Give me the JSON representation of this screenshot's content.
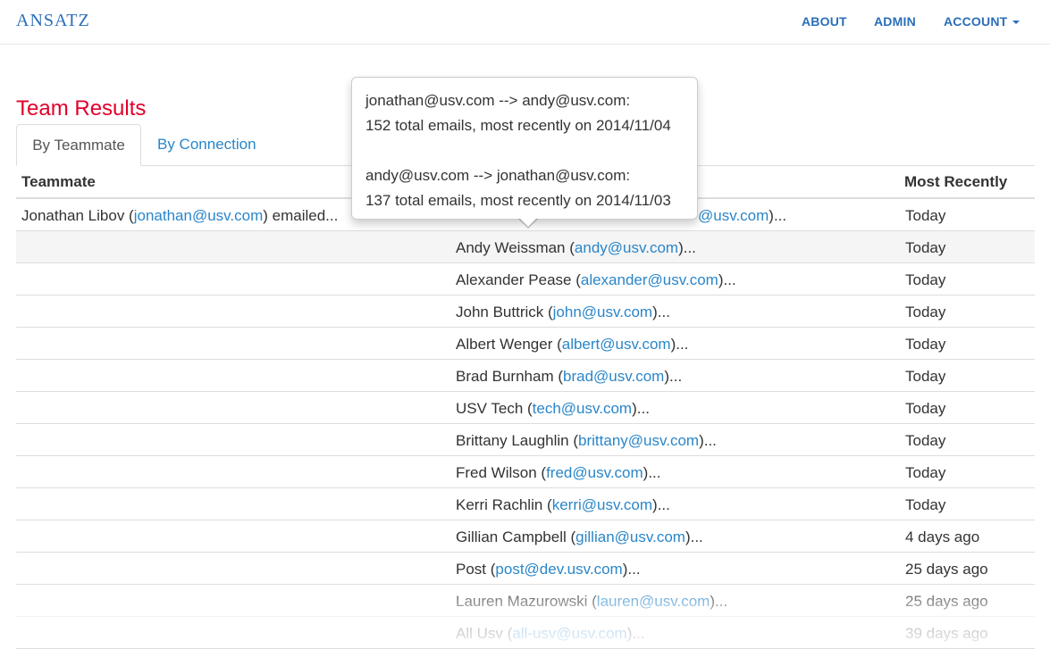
{
  "nav": {
    "brand": "ANSATZ",
    "links": [
      {
        "label": "ABOUT"
      },
      {
        "label": "ADMIN"
      },
      {
        "label": "ACCOUNT"
      }
    ]
  },
  "page": {
    "title": "Team Results"
  },
  "tabs": [
    {
      "label": "By Teammate",
      "active": true
    },
    {
      "label": "By Connection",
      "active": false
    }
  ],
  "table": {
    "headers": [
      "Teammate",
      "",
      "Most Recently"
    ],
    "first_row": {
      "name": "Jonathan Libov",
      "email": "jonathan@usv.com",
      "suffix": " emailed...",
      "hidden_tail": "@usv.com",
      "hidden_tail_after": ")...",
      "recent": "Today"
    },
    "rows": [
      {
        "name": "Andy Weissman",
        "email": "andy@usv.com",
        "recent": "Today"
      },
      {
        "name": "Alexander Pease",
        "email": "alexander@usv.com",
        "recent": "Today"
      },
      {
        "name": "John Buttrick",
        "email": "john@usv.com",
        "recent": "Today"
      },
      {
        "name": "Albert Wenger",
        "email": "albert@usv.com",
        "recent": "Today"
      },
      {
        "name": "Brad Burnham",
        "email": "brad@usv.com",
        "recent": "Today"
      },
      {
        "name": "USV Tech",
        "email": "tech@usv.com",
        "recent": "Today"
      },
      {
        "name": "Brittany Laughlin",
        "email": "brittany@usv.com",
        "recent": "Today"
      },
      {
        "name": "Fred Wilson",
        "email": "fred@usv.com",
        "recent": "Today"
      },
      {
        "name": "Kerri Rachlin",
        "email": "kerri@usv.com",
        "recent": "Today"
      },
      {
        "name": "Gillian Campbell",
        "email": "gillian@usv.com",
        "recent": "4 days ago"
      },
      {
        "name": "Post",
        "email": "post@dev.usv.com",
        "recent": "25 days ago"
      },
      {
        "name": "Lauren Mazurowski",
        "email": "lauren@usv.com",
        "recent": "25 days ago"
      },
      {
        "name": "All Usv",
        "email": "all-usv@usv.com",
        "recent": "39 days ago"
      }
    ]
  },
  "popover": {
    "line1": "jonathan@usv.com --> andy@usv.com:",
    "line2": "152 total emails, most recently on 2014/11/04",
    "line3": "andy@usv.com --> jonathan@usv.com:",
    "line4": "137 total emails, most recently on 2014/11/03"
  }
}
